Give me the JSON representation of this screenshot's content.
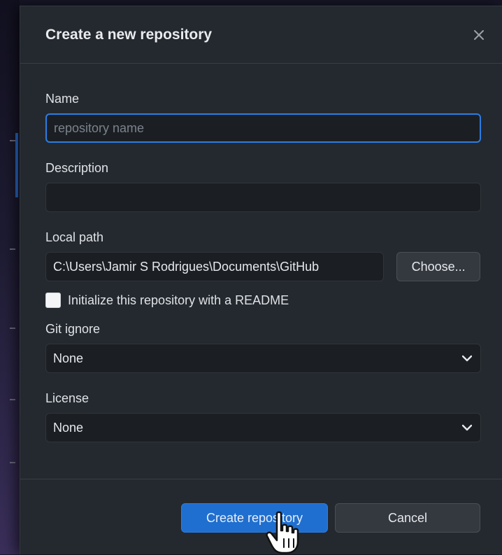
{
  "dialog": {
    "title": "Create a new repository",
    "close_glyph": "✕"
  },
  "form": {
    "name": {
      "label": "Name",
      "value": "",
      "placeholder": "repository name"
    },
    "description": {
      "label": "Description",
      "value": ""
    },
    "local_path": {
      "label": "Local path",
      "value": "C:\\Users\\Jamir S Rodrigues\\Documents\\GitHub",
      "choose_label": "Choose..."
    },
    "readme": {
      "label": "Initialize this repository with a README",
      "checked": false
    },
    "git_ignore": {
      "label": "Git ignore",
      "selected": "None"
    },
    "license": {
      "label": "License",
      "selected": "None"
    }
  },
  "footer": {
    "create_label": "Create repository",
    "cancel_label": "Cancel"
  },
  "colors": {
    "accent": "#1f6fd0",
    "focus_border": "#2c7de3",
    "modal_bg": "#24292f",
    "input_bg": "#1b1f24"
  },
  "icons": {
    "close": "close-icon",
    "dropdown": "chevron-down-icon",
    "cursor": "hand-pointer-cursor-icon"
  }
}
